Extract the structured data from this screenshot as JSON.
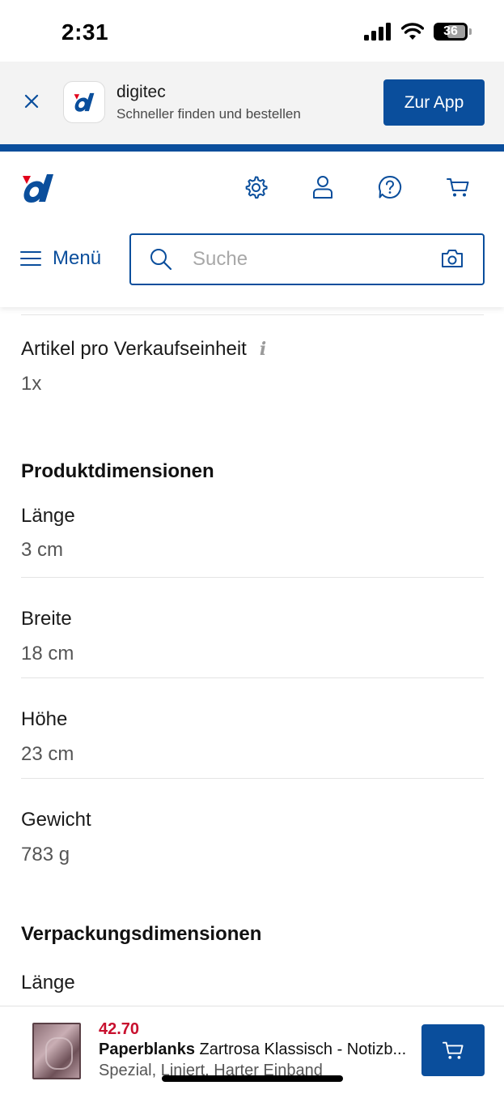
{
  "status_bar": {
    "time": "2:31",
    "battery": "36"
  },
  "app_banner": {
    "app_name": "digitec",
    "subtitle": "Schneller finden und bestellen",
    "cta_label": "Zur App"
  },
  "header": {
    "icons": [
      "gear-icon",
      "user-icon",
      "help-icon",
      "cart-icon"
    ],
    "menu_label": "Menü",
    "search_placeholder": "Suche"
  },
  "specs": {
    "unit_row": {
      "label": "Artikel pro Verkaufseinheit",
      "value": "1x"
    },
    "product_dimensions": {
      "title": "Produktdimensionen",
      "rows": [
        {
          "label": "Länge",
          "value": "3 cm"
        },
        {
          "label": "Breite",
          "value": "18 cm"
        },
        {
          "label": "Höhe",
          "value": "23 cm"
        },
        {
          "label": "Gewicht",
          "value": "783 g"
        }
      ]
    },
    "packaging_dimensions": {
      "title": "Verpackungsdimensionen",
      "rows": [
        {
          "label": "Länge"
        }
      ]
    }
  },
  "bottom_bar": {
    "price": "42.70",
    "brand": "Paperblanks",
    "name": "Zartrosa Klassisch - Notizb...",
    "variant": "Spezial, Liniert, Harter Einband"
  },
  "colors": {
    "brand_blue": "#0a4e9c",
    "price_red": "#c8102e"
  }
}
